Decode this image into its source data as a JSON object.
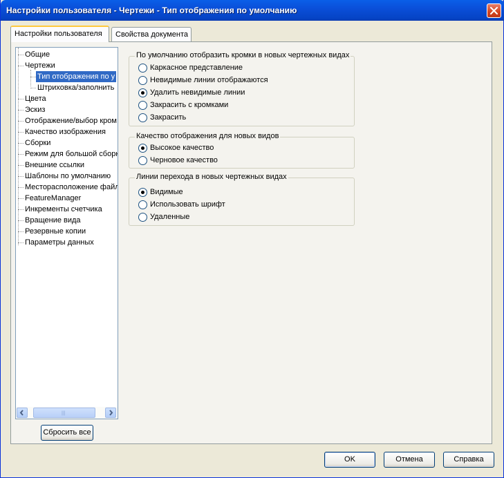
{
  "window": {
    "title": "Настройки пользователя - Чертежи - Тип отображения по умолчанию"
  },
  "tabs": [
    {
      "label": "Настройки пользователя",
      "active": true
    },
    {
      "label": "Свойства документа",
      "active": false
    }
  ],
  "tree": {
    "items": [
      {
        "label": "Общие",
        "level": 0
      },
      {
        "label": "Чертежи",
        "level": 0
      },
      {
        "label": "Тип отображения по у",
        "level": 1,
        "selected": true
      },
      {
        "label": "Штриховка/заполнить",
        "level": 1
      },
      {
        "label": "Цвета",
        "level": 0
      },
      {
        "label": "Эскиз",
        "level": 0
      },
      {
        "label": "Отображение/выбор кром",
        "level": 0
      },
      {
        "label": "Качество изображения",
        "level": 0
      },
      {
        "label": "Сборки",
        "level": 0
      },
      {
        "label": "Режим для большой сборк",
        "level": 0
      },
      {
        "label": "Внешние ссылки",
        "level": 0
      },
      {
        "label": "Шаблоны по умолчанию",
        "level": 0
      },
      {
        "label": "Месторасположение файл",
        "level": 0
      },
      {
        "label": "FeatureManager",
        "level": 0
      },
      {
        "label": "Инкременты счетчика",
        "level": 0
      },
      {
        "label": "Вращение вида",
        "level": 0
      },
      {
        "label": "Резервные копии",
        "level": 0
      },
      {
        "label": "Параметры данных",
        "level": 0
      }
    ],
    "reset_button": "Сбросить все"
  },
  "groups": {
    "edges": {
      "title": "По умолчанию отобразить кромки в новых чертежных видах",
      "options": [
        {
          "label": "Каркасное представление",
          "checked": false
        },
        {
          "label": "Невидимые линии отображаются",
          "checked": false
        },
        {
          "label": "Удалить невидимые линии",
          "checked": true
        },
        {
          "label": "Закрасить с кромками",
          "checked": false
        },
        {
          "label": "Закрасить",
          "checked": false
        }
      ]
    },
    "quality": {
      "title": "Качество отображения для новых видов",
      "options": [
        {
          "label": "Высокое качество",
          "checked": true
        },
        {
          "label": "Черновое качество",
          "checked": false
        }
      ]
    },
    "tangent": {
      "title": "Линии перехода в новых чертежных видах",
      "options": [
        {
          "label": "Видимые",
          "checked": true
        },
        {
          "label": "Использовать шрифт",
          "checked": false
        },
        {
          "label": "Удаленные",
          "checked": false
        }
      ]
    }
  },
  "buttons": {
    "ok": "OK",
    "cancel": "Отмена",
    "help": "Справка"
  },
  "colors": {
    "titlebar": "#0a4fd9",
    "selection": "#316ac5",
    "dialog_bg": "#ece9d8",
    "close": "#d6441e"
  }
}
